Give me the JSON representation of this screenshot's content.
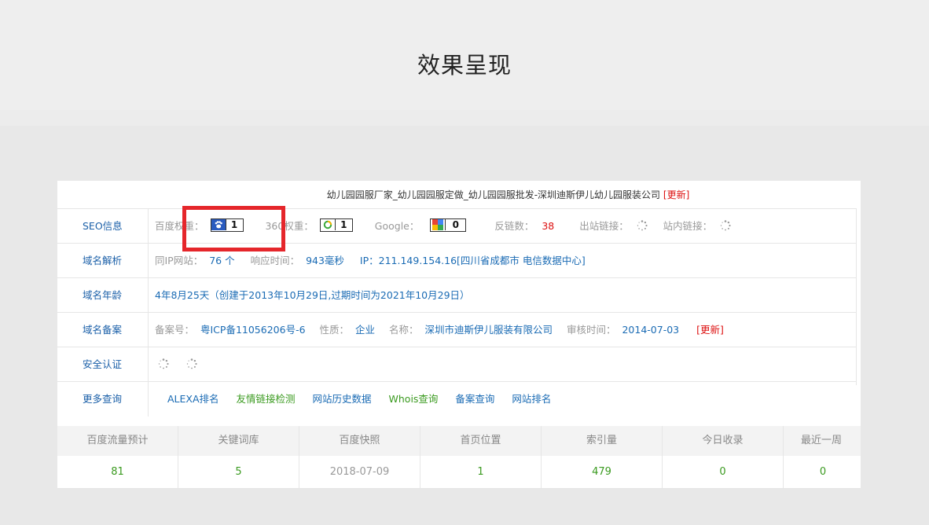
{
  "page": {
    "title": "效果呈现"
  },
  "site": {
    "title": "幼儿园园服厂家_幼儿园园服定做_幼儿园园服批发-深圳迪斯伊儿幼儿园服装公司",
    "update_label": "[更新]"
  },
  "seo": {
    "label": "SEO信息",
    "baidu_label": "百度权重：",
    "baidu_value": "1",
    "s360_label": "360权重：",
    "s360_value": "1",
    "google_label": "Google：",
    "google_value": "0",
    "backlinks_label": "反链数：",
    "backlinks_value": "38",
    "outbound_label": "出站链接：",
    "internal_label": "站内链接："
  },
  "dns": {
    "label": "域名解析",
    "same_ip_label": "同IP网站：",
    "same_ip_value": "76 个",
    "response_label": "响应时间：",
    "response_value": "943毫秒",
    "ip_text": "IP：211.149.154.16[四川省成都市 电信数据中心]"
  },
  "age": {
    "label": "域名年龄",
    "value": "4年8月25天（创建于2013年10月29日,过期时间为2021年10月29日）"
  },
  "icp": {
    "label": "域名备案",
    "number_label": "备案号：",
    "number_value": "粤ICP备11056206号-6",
    "nature_label": "性质：",
    "nature_value": "企业",
    "name_label": "名称：",
    "name_value": "深圳市迪斯伊儿服装有限公司",
    "audit_label": "审核时间：",
    "audit_value": "2014-07-03",
    "update_label": "[更新]"
  },
  "security": {
    "label": "安全认证"
  },
  "more": {
    "label": "更多查询",
    "links": [
      "ALEXA排名",
      "友情链接检测",
      "网站历史数据",
      "Whois查询",
      "备案查询",
      "网站排名"
    ]
  },
  "stats": {
    "headers": [
      "百度流量预计",
      "关键词库",
      "百度快照",
      "首页位置",
      "索引量",
      "今日收录",
      "最近一周"
    ],
    "values": [
      "81",
      "5",
      "2018-07-09",
      "1",
      "479",
      "0",
      "0"
    ]
  },
  "colors": {
    "label_blue": "#1a5fa8",
    "link_blue": "#1a6bb4",
    "green": "#3a9a1f",
    "red": "#d11111",
    "highlight_red": "#e5262b"
  }
}
